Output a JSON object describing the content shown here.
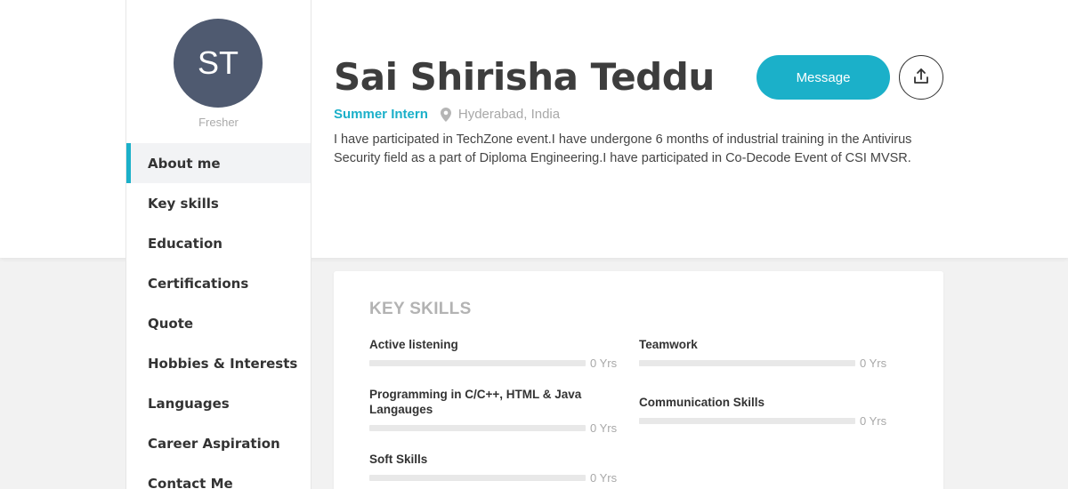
{
  "profile": {
    "initials": "ST",
    "status": "Fresher",
    "name": "Sai Shirisha Teddu",
    "role": "Summer Intern",
    "location": "Hyderabad, India",
    "about": "I have participated in TechZone event.I have undergone 6 months of industrial training in the Antivirus Security field as a part of Diploma Engineering.I have participated in Co-Decode Event of CSI MVSR."
  },
  "actions": {
    "message_label": "Message",
    "share_icon": "share-upload-icon"
  },
  "sidebar": {
    "items": [
      {
        "label": "About me",
        "active": true
      },
      {
        "label": "Key skills"
      },
      {
        "label": "Education"
      },
      {
        "label": "Certifications"
      },
      {
        "label": "Quote"
      },
      {
        "label": "Hobbies & Interests"
      },
      {
        "label": "Languages"
      },
      {
        "label": "Career Aspiration"
      },
      {
        "label": "Contact Me"
      }
    ]
  },
  "skills": {
    "title": "KEY SKILLS",
    "items": [
      {
        "name": "Active listening",
        "years": "0 Yrs"
      },
      {
        "name": "Teamwork",
        "years": "0 Yrs"
      },
      {
        "name": "Programming in C/C++, HTML & Java Langauges",
        "years": "0 Yrs"
      },
      {
        "name": "Communication Skills",
        "years": "0 Yrs"
      },
      {
        "name": "Soft Skills",
        "years": "0 Yrs"
      }
    ]
  },
  "colors": {
    "accent": "#1bb0c9",
    "avatar_bg": "#4f5a70"
  }
}
